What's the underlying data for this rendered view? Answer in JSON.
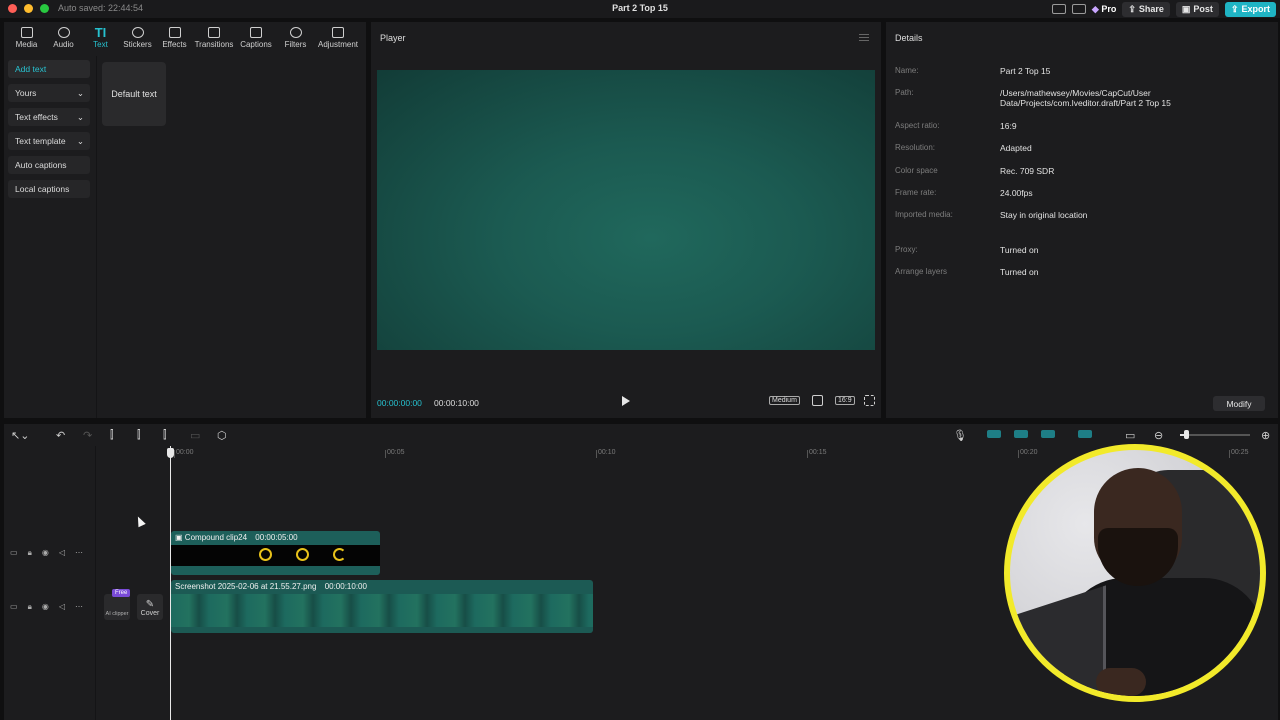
{
  "titlebar": {
    "autosave": "Auto saved: 22:44:54",
    "project_title": "Part 2 Top 15",
    "pro_label": "Pro",
    "share_label": "Share",
    "post_label": "Post",
    "export_label": "Export"
  },
  "toolbar": {
    "media": "Media",
    "audio": "Audio",
    "text": "Text",
    "stickers": "Stickers",
    "effects": "Effects",
    "transitions": "Transitions",
    "captions": "Captions",
    "filters": "Filters",
    "adjustment": "Adjustment"
  },
  "sidebar": {
    "items": [
      {
        "label": "Add text"
      },
      {
        "label": "Yours"
      },
      {
        "label": "Text effects"
      },
      {
        "label": "Text template"
      },
      {
        "label": "Auto captions"
      },
      {
        "label": "Local captions"
      }
    ]
  },
  "text_panel": {
    "default_text": "Default text"
  },
  "player": {
    "title": "Player",
    "current_time": "00:00:00:00",
    "duration": "00:00:10:00",
    "quality": "Medium",
    "ratio": "16:9"
  },
  "details": {
    "title": "Details",
    "rows": [
      {
        "label": "Name:",
        "value": "Part 2 Top 15"
      },
      {
        "label": "Path:",
        "value": "/Users/mathewsey/Movies/CapCut/User Data/Projects/com.lveditor.draft/Part 2 Top 15"
      },
      {
        "label": "Aspect ratio:",
        "value": "16:9"
      },
      {
        "label": "Resolution:",
        "value": "Adapted"
      },
      {
        "label": "Color space",
        "value": "Rec. 709 SDR"
      },
      {
        "label": "Frame rate:",
        "value": "24.00fps"
      },
      {
        "label": "Imported media:",
        "value": "Stay in original location"
      },
      {
        "label": "Proxy:",
        "value": "Turned on"
      },
      {
        "label": "Arrange layers",
        "value": "Turned on"
      }
    ],
    "modify_label": "Modify"
  },
  "timeline": {
    "ruler": [
      "00:00",
      "00:05",
      "00:10",
      "00:15",
      "00:20",
      "00:25"
    ],
    "clips": [
      {
        "name": "Compound clip24",
        "duration": "00:00:05:00"
      },
      {
        "name": "Screenshot 2025-02-06 at 21.55.27.png",
        "duration": "00:00:10:00"
      }
    ],
    "free_badge": "Free",
    "ai_clipper_label": "AI clipper",
    "cover_label": "Cover"
  },
  "colors": {
    "accent": "#26c1cf",
    "export": "#1fb4c4",
    "clip_teal": "#1d5f5a",
    "webcam_ring": "#f2ea2a"
  }
}
